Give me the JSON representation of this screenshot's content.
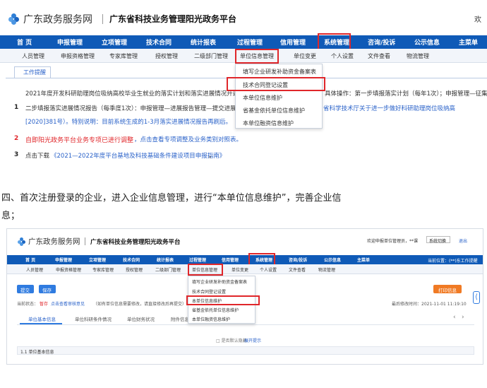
{
  "shot1": {
    "site_name": "广东政务服务网",
    "platform_title": "广东省科技业务管理阳光政务平台",
    "top_right_text": "欢",
    "nav": [
      "首 页",
      "申报管理",
      "立项管理",
      "技术合同",
      "统计报表",
      "过程管理",
      "信用管理",
      "系统管理",
      "咨询/投诉",
      "公示信息",
      "主菜单"
    ],
    "subnav": [
      "人员管理",
      "申报资格管理",
      "专家库管理",
      "授权管理",
      "二级部门管理",
      "单位信息管理",
      "单位变更",
      "个人设置",
      "文件查看",
      "物流管理"
    ],
    "tab_label": "工作提醒",
    "dropdown": [
      "填写企业研发补助资金备案表",
      "技术合同登记设置",
      "本单位信息维护",
      "省基金依托单位信息维护",
      "本单位融资信息维护"
    ],
    "line0": "2021年度开发科研助理岗位吸纳高校毕业生就业的落实计划和落实进展情况开通填报",
    "line0_right": "具体操作：第一步填报落实计划（每年1次）；申报管理—征集",
    "item1_num": "1",
    "item1_text": "二步填报落实进展情况报告（每季度1次）：申报管理—进展报告管理—提交进展报告",
    "item1_right": "省科学技术厅关于进一步做好科研助理岗位吸纳高",
    "item1_link": "[2020]381号）。特别说明：目前系统生成的1-3月落实进展情况报告再刷后。",
    "item2_num": "2",
    "item2_red": "自即阳光政务平台业务专项已进行调整",
    "item2_blue": "，点击查看专项调整及业务类别对照表。",
    "item3_num": "3",
    "item3_text": "点击下载",
    "item3_link": "《2021—2022年度平台基地及科技基础条件建设项目申报指南》",
    "item3_end": "。"
  },
  "instruction": {
    "line1": "四、首次注册登录的企业，进入企业信息管理，进行“本单位信息维护”，完善企业信",
    "line2": "息；"
  },
  "shot2": {
    "site_name": "广东政务服务网",
    "platform_title": "广东省科技业务管理阳光政务平台",
    "user_text": "欢迎申报单位管理员，**课",
    "switch_label": "系统切换",
    "exit_label": "退出",
    "position_label": "当前位置：",
    "position_value": "(**)东工作提醒",
    "nav": [
      "首 页",
      "申报管理",
      "立项管理",
      "技术合同",
      "统计报表",
      "过程管理",
      "信用管理",
      "系统管理",
      "咨询/投诉",
      "公示信息",
      "主菜单"
    ],
    "subnav": [
      "人员管理",
      "申报资格管理",
      "专家库管理",
      "授权管理",
      "二级部门管理",
      "单位信息管理",
      "单位变更",
      "个人设置",
      "文件查看",
      "物流管理"
    ],
    "submit_label": "提交",
    "save_label": "保存",
    "print_label": "打印信息",
    "status_prefix": "当前状态：",
    "status_value": "暂存",
    "status_link": "点击查看审核意见",
    "status_note": "（如有单位信息需要修改，请直接修改后再提交）",
    "last_modified": "最后修改时间：2021-11-01 11:19:10",
    "tabs": [
      "单位基本信息",
      "单位科研条件情况",
      "单位财务状况",
      "附件信息"
    ],
    "hint_text": "□ 是否默认隐藏",
    "hint_link": "展开提示",
    "section_title": "1.1 单位基本信息",
    "dropdown": [
      "填写企业研发补助资金备案表",
      "技术合同登记设置",
      "本单位信息维护",
      "省基金依托单位信息维护",
      "本单位融资信息维护"
    ]
  },
  "colors": {
    "nav_bg": "#0f5ab7",
    "highlight": "#e0262a",
    "link": "#2a62c9",
    "orange": "#f07a24",
    "blue_btn": "#2f7be0"
  }
}
